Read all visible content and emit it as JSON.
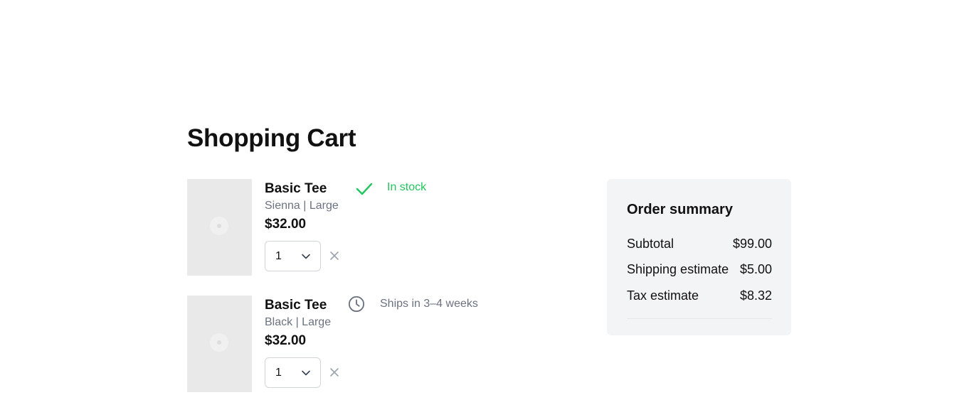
{
  "page": {
    "title": "Shopping Cart"
  },
  "cart": {
    "items": [
      {
        "name": "Basic Tee",
        "variant": "Sienna | Large",
        "price": "$32.00",
        "quantity": "1",
        "stock_status": "In stock",
        "stock_icon": "check-icon",
        "stock_color": "#22c55e"
      },
      {
        "name": "Basic Tee",
        "variant": "Black | Large",
        "price": "$32.00",
        "quantity": "1",
        "stock_status": "Ships in 3–4 weeks",
        "stock_icon": "clock-icon",
        "stock_color": "#6b7280"
      }
    ]
  },
  "summary": {
    "title": "Order summary",
    "subtotal_label": "Subtotal",
    "subtotal_value": "$99.00",
    "shipping_label": "Shipping estimate",
    "shipping_value": "$5.00",
    "tax_label": "Tax estimate",
    "tax_value": "$8.32"
  },
  "colors": {
    "in_stock": "#22c55e",
    "muted_text": "#6b7280",
    "summary_bg": "#f3f4f6"
  }
}
